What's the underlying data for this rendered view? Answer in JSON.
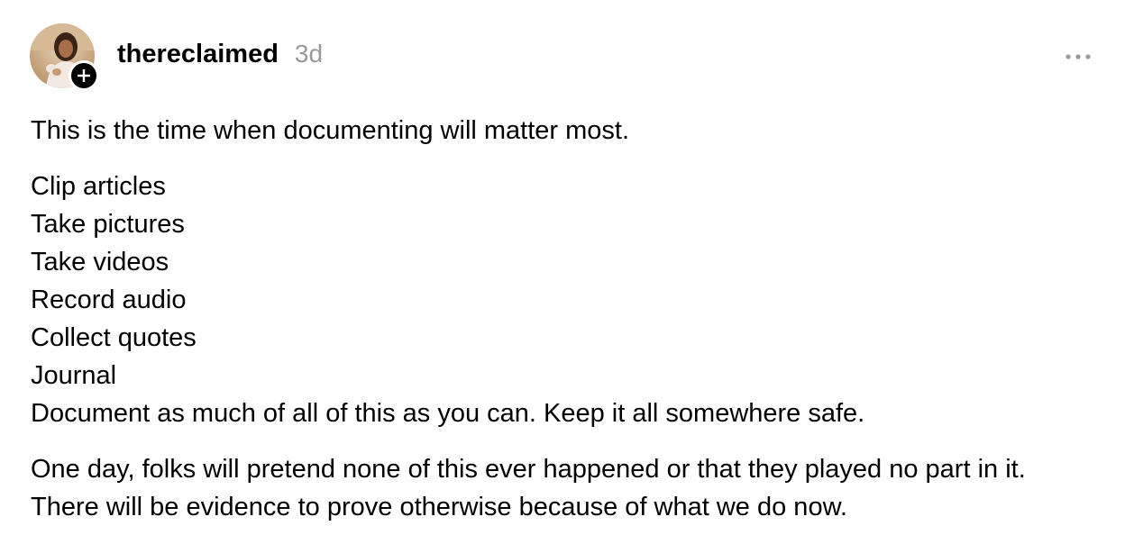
{
  "post": {
    "username": "thereclaimed",
    "timestamp": "3d",
    "paragraphs": [
      {
        "lines": [
          "This is the time when documenting will matter most."
        ]
      },
      {
        "lines": [
          "Clip articles",
          "Take pictures",
          "Take videos",
          "Record audio",
          "Collect quotes",
          "Journal",
          "Document as much of all of this as you can. Keep it all somewhere safe."
        ]
      },
      {
        "lines": [
          "One day, folks will pretend none of this ever happened or that they played no part in it.",
          "There will be evidence to prove otherwise because of what we do now."
        ]
      }
    ]
  },
  "icons": {
    "follow": "plus-icon",
    "more": "more-options-icon"
  },
  "colors": {
    "text": "#000000",
    "muted": "#999999",
    "badge": "#000000"
  }
}
